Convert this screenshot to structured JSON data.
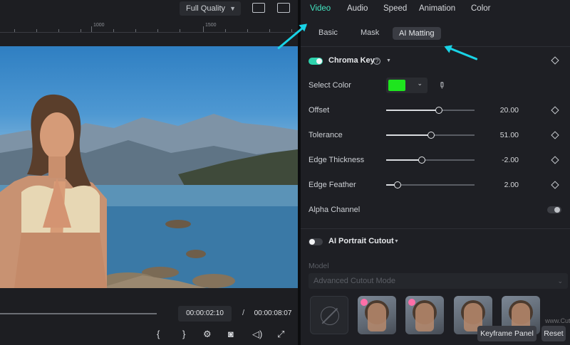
{
  "preview": {
    "quality": "Full Quality",
    "ruler": {
      "label_1000": "1000",
      "label_1500": "1500"
    },
    "current_time": "00:00:02:10",
    "separator": "/",
    "total_time": "00:00:08:07",
    "controls": [
      "{",
      "}",
      "settings-icon",
      "camera-icon",
      "volume-icon",
      "fullscreen-icon"
    ]
  },
  "tabs": [
    "Video",
    "Audio",
    "Speed",
    "Animation",
    "Color"
  ],
  "active_tab": "Video",
  "subtabs": [
    "Basic",
    "Mask",
    "AI Matting"
  ],
  "active_subtab": "AI Matting",
  "chroma_key": {
    "title": "Chroma Key",
    "enabled": true,
    "select_color_label": "Select Color",
    "selected_color": "#1ee51e",
    "sliders": [
      {
        "label": "Offset",
        "value": "20.00",
        "fraction": 0.6
      },
      {
        "label": "Tolerance",
        "value": "51.00",
        "fraction": 0.51
      },
      {
        "label": "Edge Thickness",
        "value": "-2.00",
        "fraction": 0.4
      },
      {
        "label": "Edge Feather",
        "value": "2.00",
        "fraction": 0.13
      }
    ],
    "alpha_channel_label": "Alpha Channel",
    "alpha_channel_enabled": false
  },
  "ai_portrait": {
    "title": "AI Portrait Cutout",
    "enabled": false,
    "model_label": "Model",
    "model_value": "Advanced Cutout Mode"
  },
  "buttons": {
    "keyframe_panel": "Keyframe Panel",
    "reset": "Reset"
  },
  "watermark": "www.Cutout.com",
  "colors": {
    "accent": "#43e6c2",
    "annotation_arrow": "#19d3e6"
  }
}
